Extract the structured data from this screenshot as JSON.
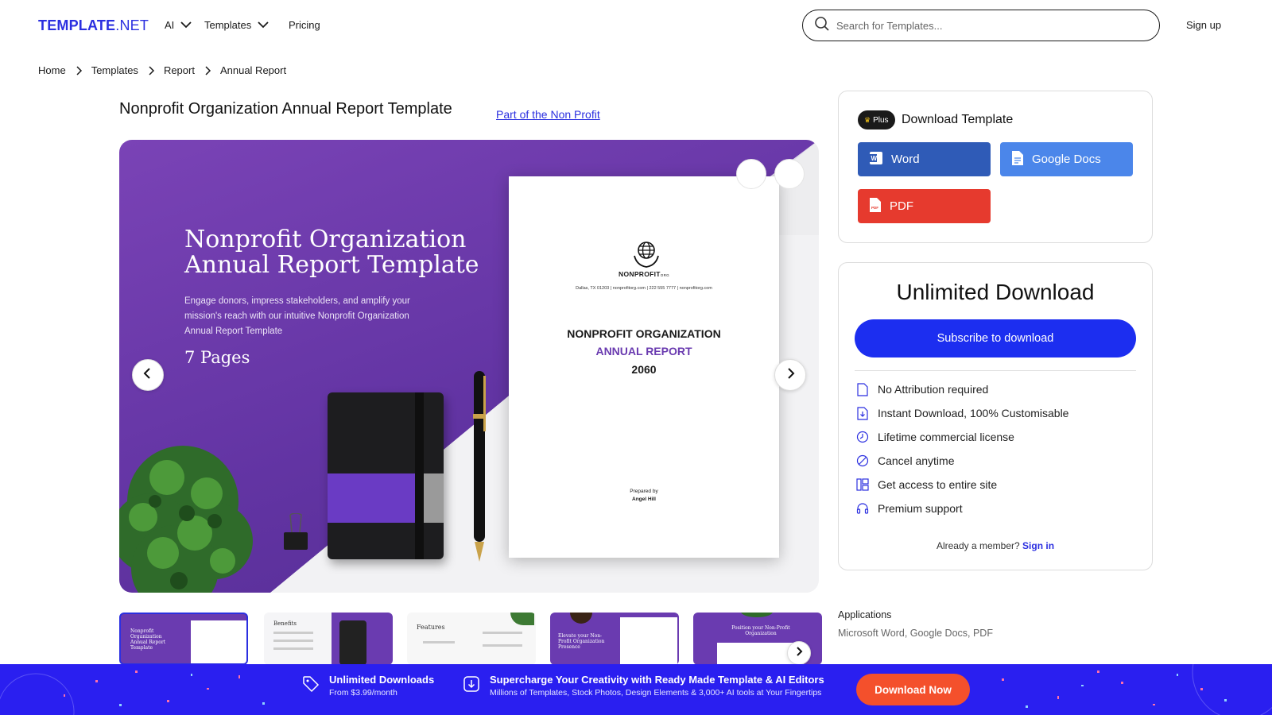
{
  "header": {
    "logo_bold": "TEMPLATE",
    "logo_rest": ".NET",
    "nav": [
      {
        "label": "AI"
      },
      {
        "label": "Templates"
      },
      {
        "label": "Pricing"
      }
    ],
    "search_placeholder": "Search for Templates...",
    "signup_label": "Sign up"
  },
  "breadcrumb": [
    "Home",
    "Templates",
    "Report",
    "Annual Report"
  ],
  "page": {
    "title": "Nonprofit Organization Annual Report Template",
    "part_of_link": "Part of the Non Profit"
  },
  "preview": {
    "hero_title": "Nonprofit Organization Annual Report Template",
    "hero_description": "Engage donors, impress stakeholders, and amplify your mission's reach with our intuitive Nonprofit Organization Annual Report Template",
    "pages": "7 Pages",
    "doc": {
      "org": "NONPROFIT",
      "org_suffix": "ORG",
      "contact": "Dallas, TX 01203   |   nonprofitorg.com   |   222 555 7777   |   nonprofitorg.com",
      "line1": "NONPROFIT ORGANIZATION",
      "line2": "ANNUAL REPORT",
      "line3": "2060",
      "prepared_label": "Prepared by",
      "prepared_name": "Angel Hill"
    }
  },
  "thumbnails": [
    {
      "label": "Nonprofit Organization Annual Report Template"
    },
    {
      "label": "Benefits"
    },
    {
      "label": "Features"
    },
    {
      "label": "Elevate your Non-Profit Organization Presence"
    },
    {
      "label": "Position your Non-Profit Organization"
    }
  ],
  "download_card": {
    "badge": "Plus",
    "title": "Download Template",
    "buttons": [
      {
        "label": "Word",
        "color": "#2f5bb7"
      },
      {
        "label": "Google Docs",
        "color": "#4b86ea"
      },
      {
        "label": "PDF",
        "color": "#e63a2e"
      }
    ]
  },
  "unlimited_card": {
    "title": "Unlimited Download",
    "subscribe_label": "Subscribe to download",
    "features": [
      {
        "icon": "file-icon",
        "label": "No Attribution required"
      },
      {
        "icon": "download-file-icon",
        "label": "Instant Download, 100% Customisable"
      },
      {
        "icon": "clock-icon",
        "label": "Lifetime commercial license"
      },
      {
        "icon": "cancel-icon",
        "label": "Cancel anytime"
      },
      {
        "icon": "grid-icon",
        "label": "Get access to entire site"
      },
      {
        "icon": "headset-icon",
        "label": "Premium support"
      }
    ],
    "member_text": "Already a member?",
    "signin_label": "Sign in"
  },
  "applications": {
    "label": "Applications",
    "value": "Microsoft Word, Google Docs, PDF"
  },
  "banner": {
    "block1_title": "Unlimited Downloads",
    "block1_sub": "From $3.99/month",
    "block2_title": "Supercharge Your Creativity with Ready Made Template & AI Editors",
    "block2_sub": "Millions of Templates, Stock Photos, Design Elements & 3,000+ AI tools at Your Fingertips",
    "cta_label": "Download Now"
  },
  "colors": {
    "brand": "#2b2fe0",
    "subscribe": "#1c2ef0",
    "banner": "#2a1ff0",
    "cta": "#f4502c",
    "purple": "#6a3bb0"
  }
}
